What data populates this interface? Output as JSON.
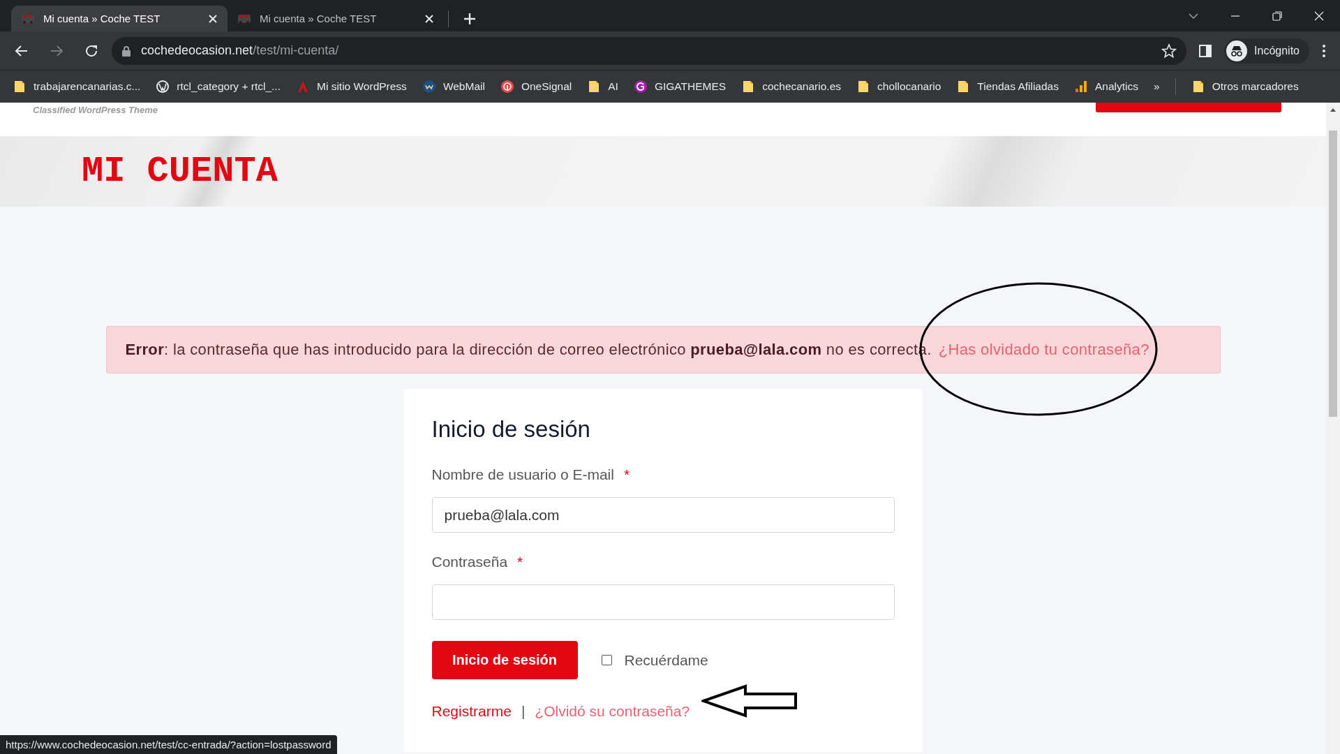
{
  "browser": {
    "tabs": [
      {
        "title": "Mi cuenta » Coche TEST",
        "selected": true
      },
      {
        "title": "Mi cuenta » Coche TEST",
        "selected": false
      }
    ],
    "address": {
      "domain": "cochedeocasion.net",
      "path": "/test/mi-cuenta/"
    },
    "profile": "Incógnito",
    "bookmarks": [
      {
        "label": "trabajarencanarias.c...",
        "kind": "folder"
      },
      {
        "label": "rtcl_category + rtcl_...",
        "kind": "wordpress"
      },
      {
        "label": "Mi sitio WordPress",
        "kind": "site"
      },
      {
        "label": "WebMail",
        "kind": "webmail"
      },
      {
        "label": "OneSignal",
        "kind": "onesignal"
      },
      {
        "label": "AI",
        "kind": "folder"
      },
      {
        "label": "GIGATHEMES",
        "kind": "giga"
      },
      {
        "label": "cochecanario.es",
        "kind": "folder"
      },
      {
        "label": "chollocanario",
        "kind": "folder"
      },
      {
        "label": "Tiendas Afiliadas",
        "kind": "folder"
      },
      {
        "label": "Analytics",
        "kind": "analytics"
      }
    ],
    "more_bookmarks": "»",
    "other_bookmarks": "Otros marcadores"
  },
  "site": {
    "tagline": "Classified WordPress Theme",
    "page_title": "MI CUENTA"
  },
  "error": {
    "text": "**Error**: la contraseña que has introducido para la dirección de correo electrónico **prueba@lala.com** no es correcta.",
    "link": "¿Has olvidado tu contraseña?"
  },
  "login": {
    "title": "Inicio de sesión",
    "fields": [
      {
        "label": "Nombre de usuario o E-mail",
        "required_mark": "*",
        "value": "prueba@lala.com"
      },
      {
        "label": "Contraseña",
        "required_mark": "*"
      }
    ],
    "submit": "Inicio de sesión",
    "remember": {
      "label": "Recuérdame",
      "checked": false
    },
    "register_link": "Registrarme",
    "separator": "|",
    "forgot_link": "¿Olvidó su contraseña?"
  },
  "status_bar": {
    "url": "https://www.cochedeocasion.net/test/cc-entrada/?action=lostpassword"
  }
}
